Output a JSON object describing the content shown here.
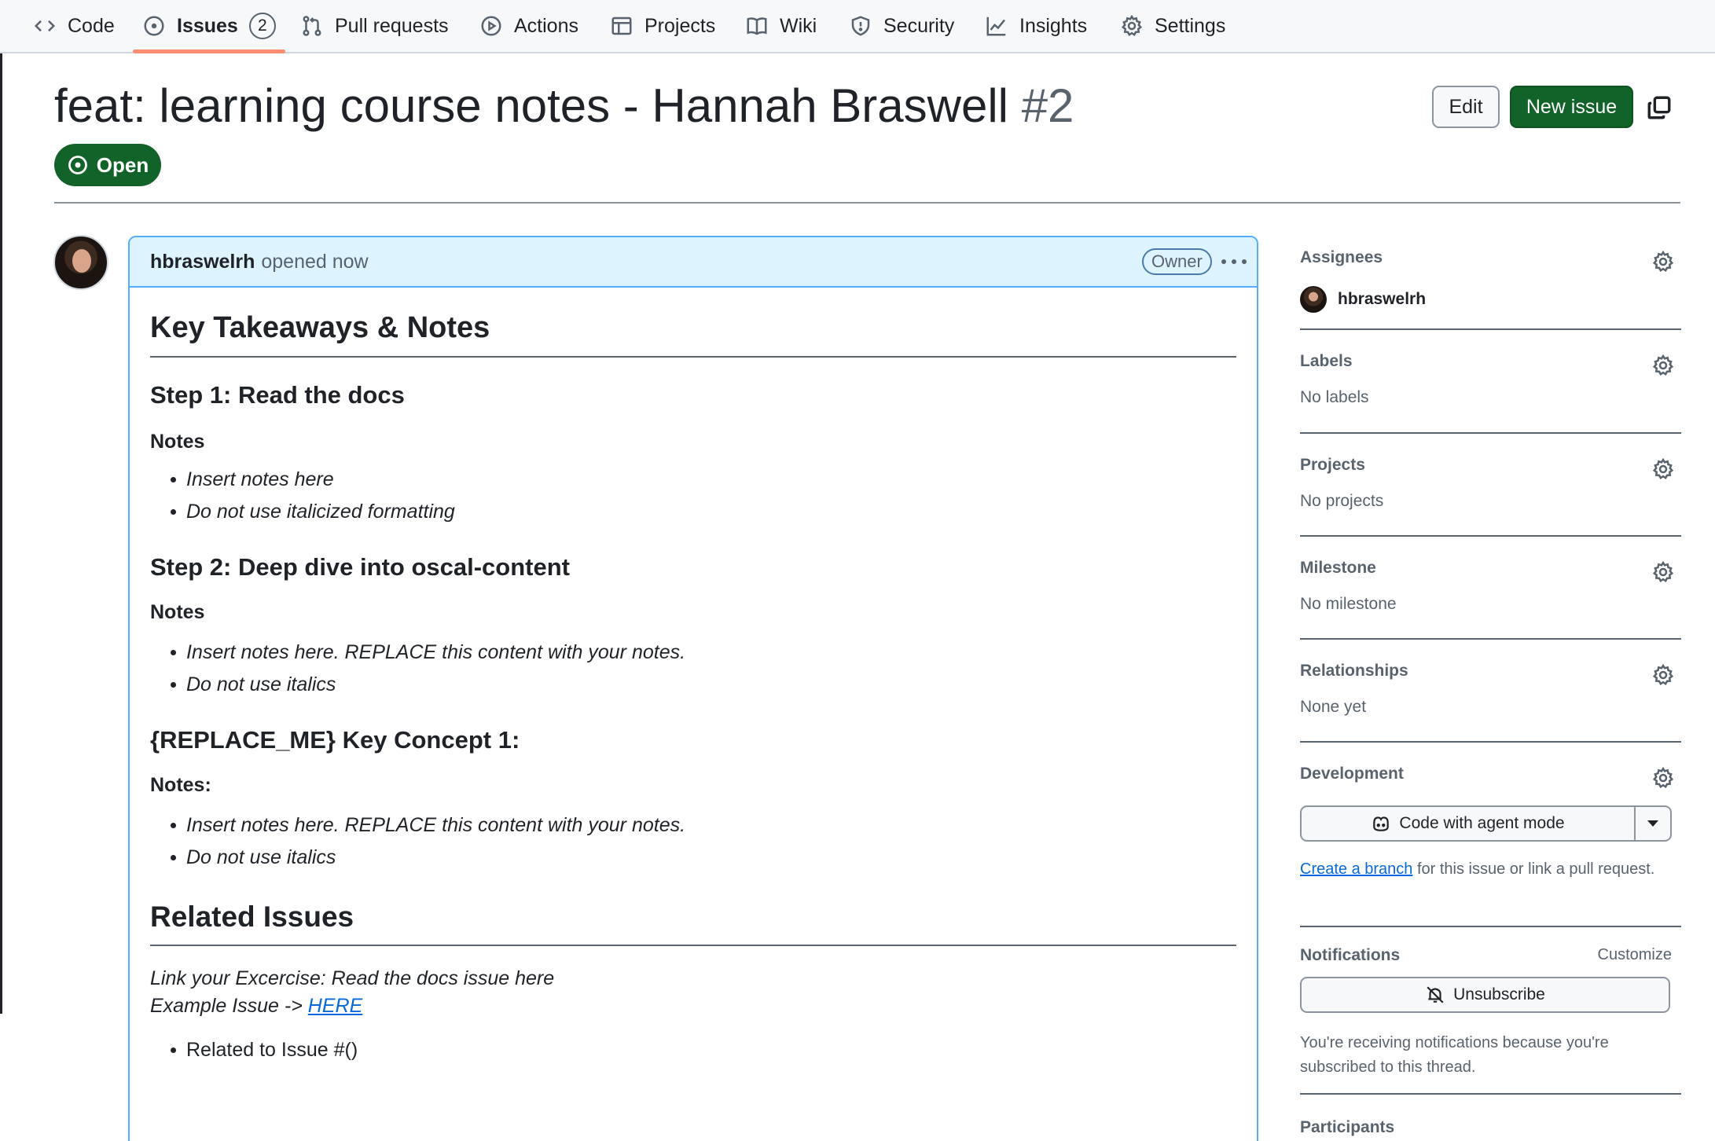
{
  "nav": {
    "tabs": [
      {
        "label": "Code",
        "icon": "code-icon"
      },
      {
        "label": "Issues",
        "icon": "issue-opened-icon",
        "count": "2"
      },
      {
        "label": "Pull requests",
        "icon": "git-pull-request-icon"
      },
      {
        "label": "Actions",
        "icon": "play-icon"
      },
      {
        "label": "Projects",
        "icon": "table-icon"
      },
      {
        "label": "Wiki",
        "icon": "book-icon"
      },
      {
        "label": "Security",
        "icon": "shield-icon"
      },
      {
        "label": "Insights",
        "icon": "graph-icon"
      },
      {
        "label": "Settings",
        "icon": "gear-icon"
      }
    ],
    "active_tab": "Issues"
  },
  "issue": {
    "title": "feat: learning course notes - Hannah Braswell",
    "number": "#2",
    "state": "Open",
    "edit_label": "Edit",
    "new_issue_label": "New issue"
  },
  "comment": {
    "author": "hbraswelrh",
    "action": "opened now",
    "role_badge": "Owner",
    "body": {
      "heading": "Key Takeaways & Notes",
      "step1": {
        "title": "Step 1: Read the docs",
        "notes_label": "Notes",
        "items": [
          "Insert notes here",
          "Do not use italicized formatting"
        ]
      },
      "step2": {
        "title": "Step 2: Deep dive into oscal-content",
        "notes_label": "Notes",
        "items": [
          "Insert notes here. REPLACE this content with your notes.",
          "Do not use italics"
        ]
      },
      "concept1": {
        "title": "{REPLACE_ME} Key Concept 1:",
        "notes_label": "Notes:",
        "items": [
          "Insert notes here. REPLACE this content with your notes.",
          "Do not use italics"
        ]
      },
      "related": {
        "title": "Related Issues",
        "line1": "Link your Excercise: Read the docs issue here",
        "line2_prefix": "Example Issue -> ",
        "line2_link": "HERE",
        "items": [
          "Related to Issue #()"
        ]
      }
    }
  },
  "sidebar": {
    "assignees": {
      "title": "Assignees",
      "user": "hbraswelrh"
    },
    "labels": {
      "title": "Labels",
      "value": "No labels"
    },
    "projects": {
      "title": "Projects",
      "value": "No projects"
    },
    "milestone": {
      "title": "Milestone",
      "value": "No milestone"
    },
    "relationships": {
      "title": "Relationships",
      "value": "None yet"
    },
    "development": {
      "title": "Development",
      "button_label": "Code with agent mode",
      "link_text": "Create a branch",
      "text_after_link": " for this issue or link a pull request."
    },
    "notifications": {
      "title": "Notifications",
      "customize": "Customize",
      "button_label": "Unsubscribe",
      "info": "You're receiving notifications because you're subscribed to this thread."
    },
    "participants": {
      "title": "Participants"
    }
  },
  "colors": {
    "open_green": "#116329",
    "link_blue": "#0969da",
    "comment_header_bg": "#ddf4ff",
    "tab_underline": "#fd8c73"
  }
}
